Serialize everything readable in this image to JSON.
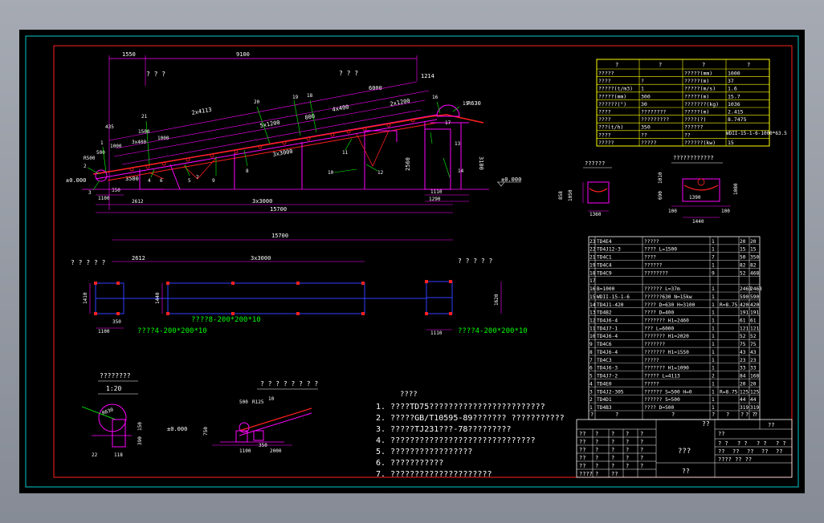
{
  "drawing": {
    "elevation": {
      "dims_top": [
        "1550",
        "9100"
      ],
      "marks_q": [
        "? ? ?",
        "? ? ?"
      ],
      "dim_6000": "6000",
      "dim_1214": "1214",
      "dim_r630": "R630",
      "dim_2x4113": "2x4113",
      "dim_5x1200": "5x1200",
      "dim_4x400": "4x400",
      "dim_2x1200": "2x1200",
      "dim_800": "800",
      "dim_3x400": "3x400",
      "dim_1500": "1500",
      "dim_1000": "1000",
      "dim_435": "435",
      "dim_1000b": "1000",
      "dim_500": "500",
      "dim_r500": "R500",
      "dim_350": "350",
      "dim_3500": "3500",
      "dim_3x3000_mid": "3x3000",
      "dim_2560": "2560",
      "dim_3100": "3100",
      "dim_1100": "1100",
      "dim_2612": "2612",
      "dim_3x3000": "3x3000",
      "dim_15700": "15700",
      "dim_1110": "1110",
      "dim_1290": "1290",
      "elev_left": "±0.000",
      "elev_right": "±0.000",
      "callouts": [
        "1",
        "2",
        "3",
        "4",
        "5",
        "6",
        "7",
        "8",
        "9",
        "10",
        "11",
        "12",
        "13",
        "14",
        "15",
        "16",
        "17",
        "18",
        "19",
        "20",
        "21"
      ]
    },
    "plan": {
      "dim_15700": "15700",
      "dim_2612": "2612",
      "dim_3x3000": "3x3000",
      "mark_left": "? ? ? ? ?",
      "mark_right": "? ? ? ? ?",
      "dim_1410": "1410",
      "dim_1440": "1440",
      "dim_1620": "1620",
      "dim_1100": "1100",
      "dim_350": "350",
      "dim_1110": "1110",
      "note_a": "????8-200*200*10",
      "note_b": "????4-200*200*10",
      "note_c": "????4-200*200*10"
    },
    "section_a": {
      "title": "??????",
      "dims": [
        "858",
        "1050",
        "1360"
      ]
    },
    "section_b": {
      "title": "????????????",
      "dims": [
        "1010",
        "690",
        "1390",
        "100",
        "100",
        "1440",
        "1080"
      ]
    },
    "detail_a": {
      "title": "????????",
      "scale": "1:20",
      "dims": [
        "R630",
        "150",
        "390",
        "22",
        "118"
      ]
    },
    "detail_b": {
      "title": "? ? ? ? ? ? ? ?",
      "dims": [
        "500",
        "R125",
        "10",
        "750",
        "350",
        "1100",
        "2000",
        "±0.000"
      ]
    },
    "notes": {
      "title": "????",
      "items": [
        "1.  ????TD75????????????????????????",
        "2.  ?????GB/T10595-89???????     ???????????",
        "3.  ?????TJ231???-78?????????",
        "4.  ??????????????????????????????",
        "5.  ?????????????????",
        "6.  ???????????",
        "7.  ?????????????????????"
      ]
    }
  },
  "spec_table": {
    "header": [
      "?",
      "?",
      "?",
      "?"
    ],
    "rows": [
      [
        "?????",
        "",
        "?????(mm)",
        "1000"
      ],
      [
        "????",
        "?",
        "?????(m)",
        "37"
      ],
      [
        "?????(t/m3)",
        "1",
        "?????(m/s)",
        "1.6"
      ],
      [
        "?????(mm)",
        "300",
        "?????(m)",
        "15.7"
      ],
      [
        "??????(°)",
        "30",
        "???????(kg)",
        "1036"
      ],
      [
        "????",
        "????????",
        "?????(m)",
        "2.415"
      ],
      [
        "????",
        "?????????",
        "????(?)",
        "8.7475"
      ],
      [
        "???(t/h)",
        "350",
        "??????",
        ""
      ],
      [
        "????",
        "??",
        "??",
        ""
      ],
      [
        "?????",
        "?????",
        "??????(kw)",
        "15"
      ]
    ],
    "side_label": "WDII-15-1-6-1000*63.5"
  },
  "parts_list": {
    "rows": [
      [
        "23",
        "TD4E4",
        "?????",
        "1",
        "",
        "20",
        "20"
      ],
      [
        "22",
        "TD4J12-3",
        "???? L=1500",
        "1",
        "",
        "15",
        "15"
      ],
      [
        "21",
        "TD4C1",
        "????",
        "7",
        "",
        "50",
        "350"
      ],
      [
        "19",
        "TD4C4",
        "??????",
        "1",
        "",
        "82",
        "82"
      ],
      [
        "18",
        "TD4C9",
        "????????",
        "9",
        "",
        "52",
        "468"
      ],
      [
        "17",
        "",
        "",
        "",
        "",
        "",
        ""
      ],
      [
        "16",
        "B=1000",
        "?????? L=37m",
        "1",
        "",
        "2463",
        "2463"
      ],
      [
        "15",
        "WDII-15-1-6",
        "??????630 N=15kw",
        "1",
        "",
        "590",
        "590"
      ],
      [
        "14",
        "TD4J1-420",
        "???? D=630 H=3100",
        "1",
        "R=8.75",
        "420",
        "420"
      ],
      [
        "13",
        "TD4B2",
        "???? D=400",
        "1",
        "",
        "191",
        "191"
      ],
      [
        "12",
        "TD4J6-4",
        "??????? H1=2460",
        "1",
        "",
        "61",
        "61"
      ],
      [
        "11",
        "TD4J7-1",
        "??? L=6000",
        "1",
        "",
        "121",
        "121"
      ],
      [
        "10",
        "TD4J6-4",
        "??????? H1=2020",
        "1",
        "",
        "52",
        "52"
      ],
      [
        "9",
        "TD4C6",
        "???????",
        "1",
        "",
        "75",
        "75"
      ],
      [
        "8",
        "TD4J6-4",
        "??????? H1=1550",
        "1",
        "",
        "43",
        "43"
      ],
      [
        "7",
        "TD4C3",
        "?????",
        "1",
        "",
        "23",
        "23"
      ],
      [
        "6",
        "TD4J6-3",
        "??????? H1=1090",
        "1",
        "",
        "33",
        "33"
      ],
      [
        "5",
        "TD4J7-2",
        "????? L=4113",
        "2",
        "",
        "84",
        "168"
      ],
      [
        "4",
        "TD4E0",
        "?????",
        "1",
        "",
        "20",
        "20"
      ],
      [
        "3",
        "TD4J2-305",
        "?????? S=500 H=0",
        "1",
        "R=8.75",
        "125",
        "125"
      ],
      [
        "2",
        "TD4D1",
        "?????? S=500",
        "1",
        "",
        "44",
        "44"
      ],
      [
        "1",
        "TD4B3",
        "???? D=500",
        "1",
        "",
        "319",
        "319"
      ]
    ],
    "header": [
      "?",
      "?",
      "?",
      "?",
      "?",
      "?",
      "? ?",
      "?"
    ],
    "header_sub": [
      "?",
      "? (kg)",
      "?"
    ]
  },
  "title_block": {
    "project": "??",
    "name": "???",
    "drawing_no": "??",
    "company": "??",
    "left_rows": [
      [
        "??",
        "?",
        "?",
        "?",
        "?"
      ],
      [
        "??",
        "?",
        "?",
        "?",
        "?"
      ],
      [
        "??",
        "?",
        "?",
        "?",
        "?"
      ],
      [
        "??",
        "?",
        "?",
        "?",
        "?"
      ],
      [
        "??",
        "?",
        "?",
        "?",
        "?"
      ],
      [
        "????",
        "?",
        "??",
        "",
        ""
      ]
    ],
    "right_head": [
      "? ?",
      "? ?",
      "? ?",
      "? ?"
    ],
    "right_row2": [
      "??",
      "??",
      "??",
      "??",
      "??"
    ],
    "scale_row": "????  ??  ??",
    "corner": "??"
  },
  "colors": {
    "background": "#000000",
    "frame": "#00c8c8",
    "border": "#ff2020",
    "structure": "#ff00ff",
    "belt": "#ff2020",
    "text": "#ffffff",
    "dimension": "#00ff00",
    "table": "#ffff00",
    "leader": "#00ffff"
  }
}
